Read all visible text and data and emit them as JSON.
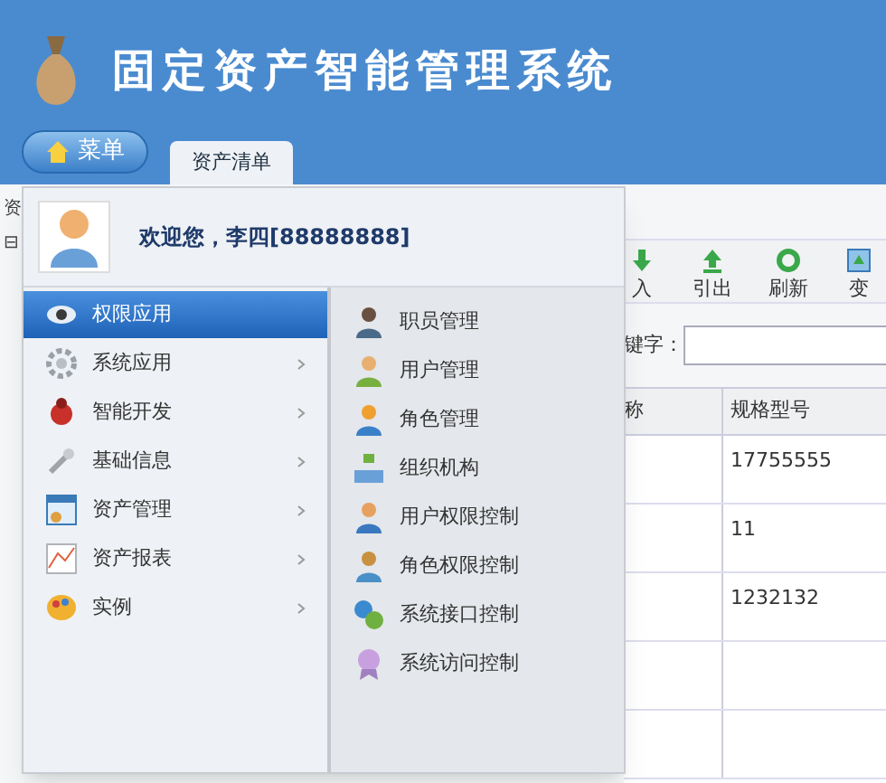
{
  "header": {
    "title": "固定资产智能管理系统",
    "menu_button": "菜单",
    "tabs": [
      {
        "label": "资产清单",
        "selected": true
      }
    ]
  },
  "background": {
    "left_strip": [
      "资",
      "⊟"
    ],
    "toolbar": [
      {
        "label": "入",
        "kind": "import"
      },
      {
        "label": "引出",
        "kind": "export"
      },
      {
        "label": "刷新",
        "kind": "refresh"
      },
      {
        "label": "变",
        "kind": "change"
      }
    ],
    "search_label": "键字：",
    "table": {
      "columns": [
        "称",
        "规格型号"
      ],
      "rows": [
        {
          "spec": "17755555"
        },
        {
          "spec": "11"
        },
        {
          "spec": "1232132"
        },
        {},
        {}
      ]
    }
  },
  "menu": {
    "greeting": "欢迎您，李四[88888888]",
    "categories": [
      {
        "label": "权限应用",
        "kind": "eye",
        "selected": true
      },
      {
        "label": "系统应用",
        "kind": "gear",
        "selected": false
      },
      {
        "label": "智能开发",
        "kind": "bug",
        "selected": false
      },
      {
        "label": "基础信息",
        "kind": "wrench",
        "selected": false
      },
      {
        "label": "资产管理",
        "kind": "window",
        "selected": false
      },
      {
        "label": "资产报表",
        "kind": "chart",
        "selected": false
      },
      {
        "label": "实例",
        "kind": "palette",
        "selected": false
      }
    ],
    "submenu": [
      {
        "label": "职员管理",
        "kind": "staff"
      },
      {
        "label": "用户管理",
        "kind": "users"
      },
      {
        "label": "角色管理",
        "kind": "person"
      },
      {
        "label": "组织机构",
        "kind": "org"
      },
      {
        "label": "用户权限控制",
        "kind": "userkey"
      },
      {
        "label": "角色权限控制",
        "kind": "group"
      },
      {
        "label": "系统接口控制",
        "kind": "link"
      },
      {
        "label": "系统访问控制",
        "kind": "badge"
      }
    ]
  }
}
